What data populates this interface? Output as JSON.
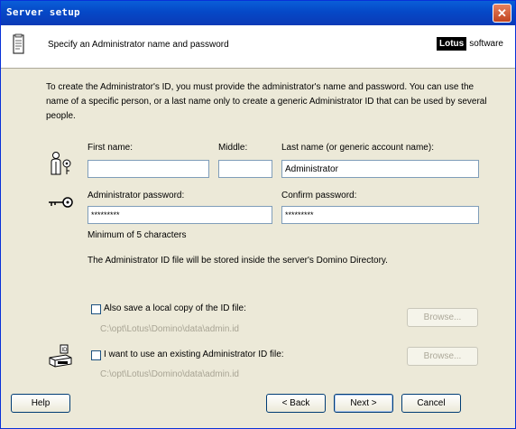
{
  "window": {
    "title": "Server setup",
    "close_label": "✕"
  },
  "header": {
    "subtitle": "Specify an Administrator name and password",
    "logo_bold": "Lotus",
    "logo_text": "software"
  },
  "intro": "To create the Administrator's ID, you must provide the administrator's name and password. You can use the name of a specific person, or a last name only to create a generic Administrator ID that can be used by several people.",
  "name_fields": {
    "first_label": "First name:",
    "first_value": "",
    "middle_label": "Middle:",
    "middle_value": "",
    "last_label": "Last name (or generic account name):",
    "last_value": "Administrator"
  },
  "password_fields": {
    "admin_label": "Administrator password:",
    "admin_value": "*********",
    "confirm_label": "Confirm password:",
    "confirm_value": "*********",
    "hint": "Minimum of 5 characters"
  },
  "info_text": "The Administrator ID file will be stored inside the server's Domino Directory.",
  "local_copy": {
    "label": "Also save a local copy of the ID file:",
    "checked": false,
    "path": "C:\\opt\\Lotus\\Domino\\data\\admin.id",
    "browse": "Browse..."
  },
  "existing_id": {
    "label": "I want to use an existing Administrator ID file:",
    "checked": false,
    "path": "C:\\opt\\Lotus\\Domino\\data\\admin.id",
    "browse": "Browse..."
  },
  "buttons": {
    "help": "Help",
    "back": "< Back",
    "next": "Next >",
    "cancel": "Cancel"
  },
  "icons": {
    "person": "person-key-icon",
    "key": "key-icon",
    "id_file": "id-file-icon",
    "document": "document-icon"
  }
}
